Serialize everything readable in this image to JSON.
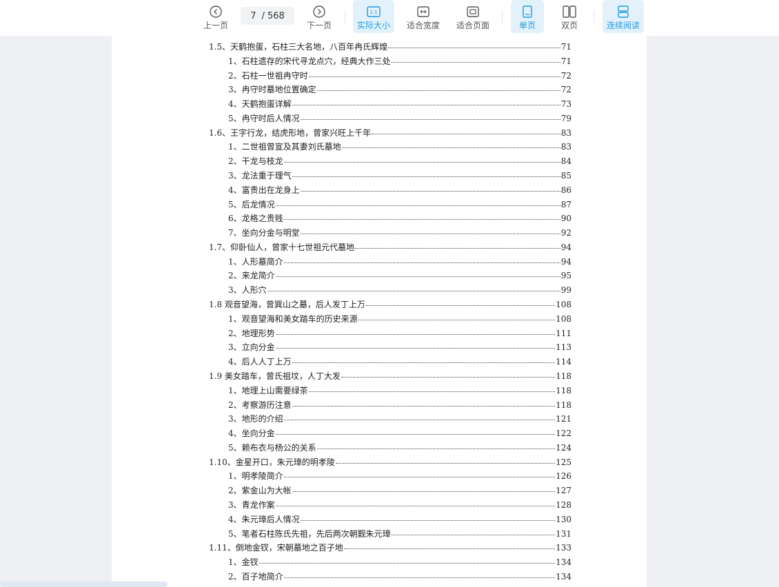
{
  "toolbar": {
    "prev_label": "上一页",
    "next_label": "下一页",
    "current_page": "7",
    "total_pages": "/ 568",
    "actual_size_label": "实际大小",
    "fit_width_label": "适合宽度",
    "fit_page_label": "适合页面",
    "single_page_label": "单页",
    "double_page_label": "双页",
    "continuous_label": "连续阅读",
    "accent_color": "#1e9be0"
  },
  "toc": [
    {
      "text": "1.5、天鹤抱蛋，石柱三大名地，八百年冉氏辉煌",
      "page": "71",
      "level": 1
    },
    {
      "text": "1、石柱遗存的宋代寻龙点穴，经典大作三处",
      "page": "71",
      "level": 2
    },
    {
      "text": "2、石柱一世祖冉守时",
      "page": "72",
      "level": 2
    },
    {
      "text": "3、冉守时墓地位置确定",
      "page": "72",
      "level": 2
    },
    {
      "text": "4、天鹤抱蛋详解",
      "page": "73",
      "level": 2
    },
    {
      "text": "5、冉守时后人情况",
      "page": "79",
      "level": 2
    },
    {
      "text": "1.6、王字行龙，结虎形地，曾家兴旺上千年",
      "page": "83",
      "level": 1
    },
    {
      "text": "1、二世祖曾宣及其妻刘氏墓地",
      "page": "83",
      "level": 2
    },
    {
      "text": "2、干龙与枝龙",
      "page": "84",
      "level": 2
    },
    {
      "text": "3、龙法重于理气",
      "page": "85",
      "level": 2
    },
    {
      "text": "4、富贵出在龙身上",
      "page": "86",
      "level": 2
    },
    {
      "text": "5、后龙情况",
      "page": "87",
      "level": 2
    },
    {
      "text": "6、龙格之贵贱",
      "page": "90",
      "level": 2
    },
    {
      "text": "7、坐向分金与明堂",
      "page": "92",
      "level": 2
    },
    {
      "text": "1.7、仰卧仙人，曾家十七世祖元代墓地",
      "page": "94",
      "level": 1
    },
    {
      "text": "1、人形墓简介",
      "page": "94",
      "level": 2
    },
    {
      "text": "2、来龙简介",
      "page": "95",
      "level": 2
    },
    {
      "text": "3、人形穴",
      "page": "99",
      "level": 2
    },
    {
      "text": "1.8 观音望海，曾巽山之墓，后人发丁上万",
      "page": "108",
      "level": 1
    },
    {
      "text": "1、观音望海和美女踏车的历史来源",
      "page": "108",
      "level": 2
    },
    {
      "text": "2、地理形势",
      "page": "111",
      "level": 2
    },
    {
      "text": "3、立向分金",
      "page": "113",
      "level": 2
    },
    {
      "text": "4、后人人丁上万",
      "page": "114",
      "level": 2
    },
    {
      "text": "1.9 美女踏车，曾氏祖坟，人丁大发",
      "page": "118",
      "level": 1
    },
    {
      "text": "1、地理上山需要绿茶",
      "page": "118",
      "level": 2
    },
    {
      "text": "2、考察游历注意",
      "page": "118",
      "level": 2
    },
    {
      "text": "3、地形的介绍",
      "page": "121",
      "level": 2
    },
    {
      "text": "4、坐向分金",
      "page": "122",
      "level": 2
    },
    {
      "text": "5、赖布衣与杨公的关系",
      "page": "124",
      "level": 2
    },
    {
      "text": "1.10、金星开口，朱元璋的明孝陵",
      "page": "125",
      "level": 1
    },
    {
      "text": "1、明孝陵简介",
      "page": "126",
      "level": 2
    },
    {
      "text": "2、紫金山为大帐",
      "page": "127",
      "level": 2
    },
    {
      "text": "3、青龙作案",
      "page": "128",
      "level": 2
    },
    {
      "text": "4、朱元璋后人情况",
      "page": "130",
      "level": 2
    },
    {
      "text": "5、笔者石柱陈氏先祖，先后两次朝觐朱元璋",
      "page": "131",
      "level": 2
    },
    {
      "text": "1.11、倒地金钗，宋朝墓地之百子地",
      "page": "133",
      "level": 1
    },
    {
      "text": "1、金钗",
      "page": "134",
      "level": 2
    },
    {
      "text": "2、百子地简介",
      "page": "134",
      "level": 2
    }
  ]
}
